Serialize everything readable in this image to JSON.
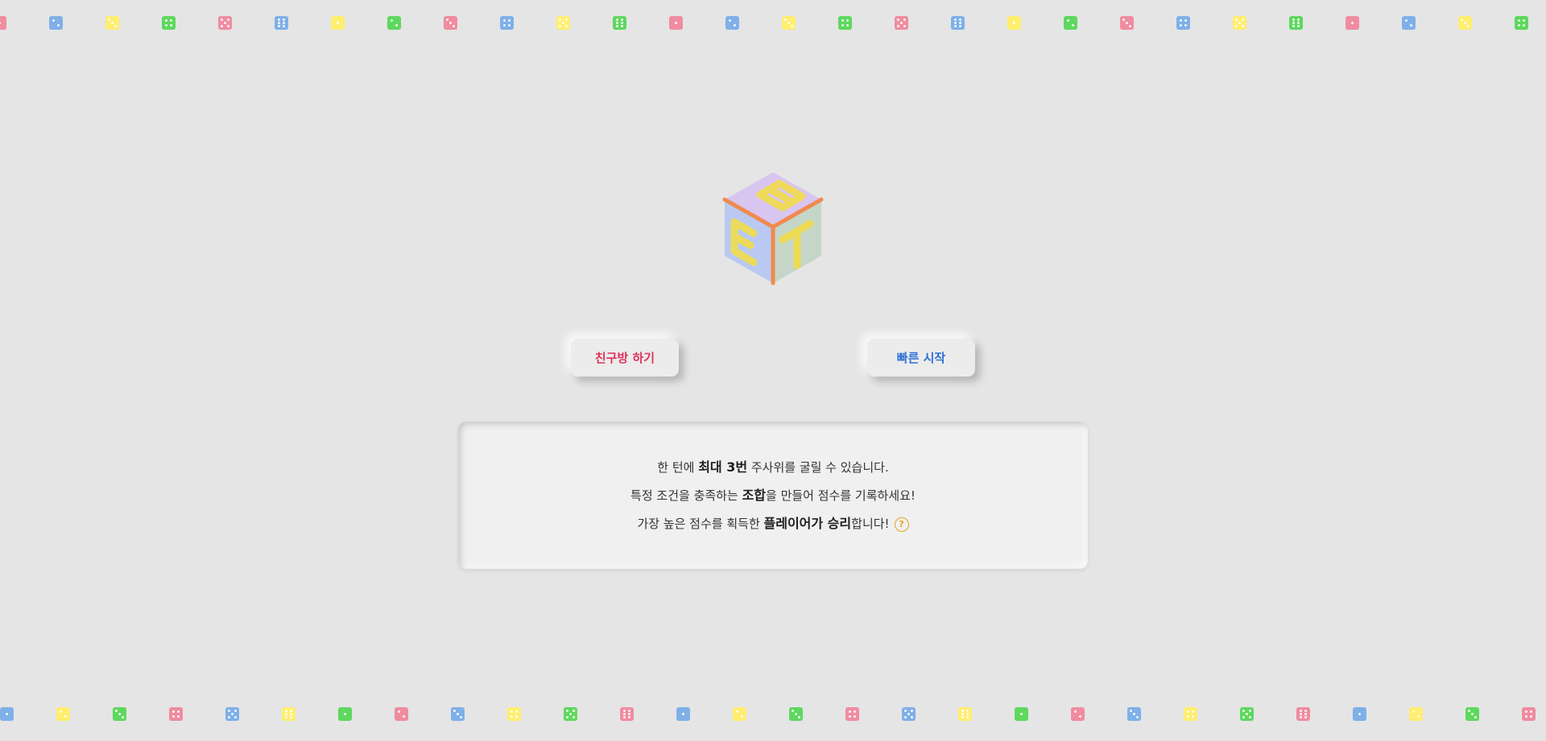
{
  "buttons": {
    "friend_room": "친구방 하기",
    "quick_start": "빠른 시작"
  },
  "logo": {
    "letters": [
      "E",
      "E",
      "T"
    ]
  },
  "info": {
    "line1": {
      "pre": "한 턴에 ",
      "bold": "최대 3번",
      "post": " 주사위를 굴릴 수 있습니다."
    },
    "line2": {
      "pre": "특정 조건을 충족하는 ",
      "bold": "조합",
      "post": "을 만들어 점수를 기록하세요!"
    },
    "line3": {
      "pre": "가장 높은 점수를 획득한 ",
      "bold": "플레이어가 승리",
      "post": "합니다!"
    },
    "help_icon": "question-circle-icon",
    "help_glyph": "?"
  },
  "colors": {
    "background": "#e5e5e5",
    "friend_text": "#e0335a",
    "quick_text": "#2f6fd6",
    "accent_orange": "#e8a21a",
    "dice": [
      "#f08ca0",
      "#7fb0e8",
      "#ffee70",
      "#5ed85e"
    ]
  }
}
